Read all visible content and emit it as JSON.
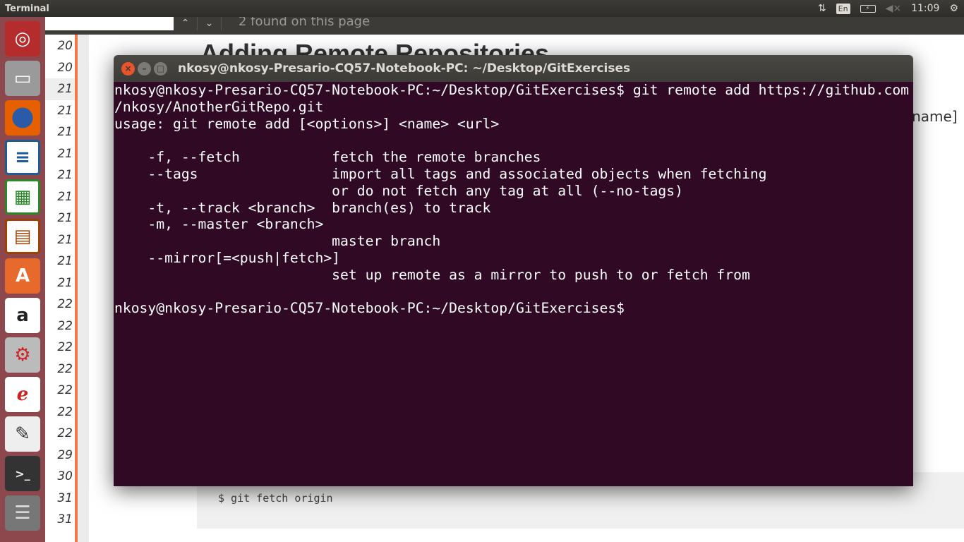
{
  "topbar": {
    "app_name": "Terminal",
    "keyboard": "En",
    "time": "11:09"
  },
  "browser": {
    "find_status": "2 found on this page",
    "heading": "Adding Remote Repositories",
    "partial_text": "rtname]",
    "code": "$ git fetch origin",
    "side_numbers": [
      "20",
      "20",
      "21",
      "21",
      "21",
      "21",
      "21",
      "21",
      "21",
      "21",
      "21",
      "21",
      "22",
      "22",
      "22",
      "22",
      "22",
      "22",
      "22",
      "29",
      "30",
      "31",
      "31"
    ]
  },
  "launcher": {
    "items": [
      "Ubuntu Dash",
      "Files",
      "Firefox",
      "LibreOffice Writer",
      "LibreOffice Calc",
      "LibreOffice Impress",
      "Ubuntu Software Center",
      "Amazon",
      "System Settings",
      "Document Viewer",
      "Text Editor",
      "Terminal",
      "Workspaces"
    ]
  },
  "terminal": {
    "title": "nkosy@nkosy-Presario-CQ57-Notebook-PC: ~/Desktop/GitExercises",
    "lines": [
      "nkosy@nkosy-Presario-CQ57-Notebook-PC:~/Desktop/GitExercises$ git remote add https://github.com",
      "/nkosy/AnotherGitRepo.git",
      "usage: git remote add [<options>] <name> <url>",
      "",
      "    -f, --fetch           fetch the remote branches",
      "    --tags                import all tags and associated objects when fetching",
      "                          or do not fetch any tag at all (--no-tags)",
      "    -t, --track <branch>  branch(es) to track",
      "    -m, --master <branch>",
      "                          master branch",
      "    --mirror[=<push|fetch>]",
      "                          set up remote as a mirror to push to or fetch from",
      "",
      "nkosy@nkosy-Presario-CQ57-Notebook-PC:~/Desktop/GitExercises$ "
    ]
  }
}
